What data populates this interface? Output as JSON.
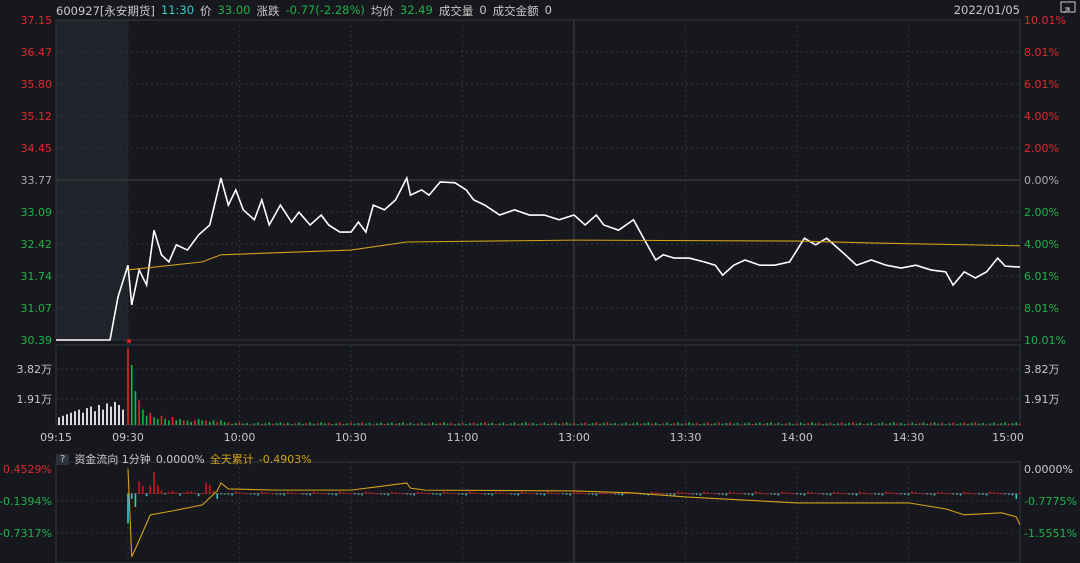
{
  "header": {
    "code_name": "600927[永安期货]",
    "time": "11:30",
    "price_label": "价",
    "price": "33.00",
    "change_label": "涨跌",
    "change": "-0.77(-2.28%)",
    "avg_label": "均价",
    "avg": "32.49",
    "volume_label": "成交量",
    "volume": "0",
    "amount_label": "成交金额",
    "amount": "0",
    "date": "2022/01/05"
  },
  "colors": {
    "up": "#e0282e",
    "down": "#1fb04a",
    "price_line": "#ffffff",
    "avg_line": "#d4a21a",
    "flow_in": "#d0161b",
    "flow_out": "#39c8c8",
    "bg": "#16181d"
  },
  "chart_data": [
    {
      "type": "line",
      "title": "分时",
      "ylim": [
        30.39,
        37.15
      ],
      "prev_close": 33.77,
      "y_ticks_left": [
        "37.15",
        "36.47",
        "35.80",
        "35.12",
        "34.45",
        "33.77",
        "33.09",
        "32.42",
        "31.74",
        "31.07",
        "30.39"
      ],
      "y_ticks_right": [
        "10.01%",
        "8.01%",
        "6.01%",
        "4.00%",
        "2.00%",
        "0.00%",
        "2.00%",
        "4.00%",
        "6.01%",
        "8.01%",
        "10.01%"
      ],
      "x_ticks": [
        "09:15",
        "09:30",
        "10:00",
        "10:30",
        "11:00",
        "13:00",
        "13:30",
        "14:00",
        "14:30",
        "15:00"
      ],
      "premarket_price": 30.39,
      "price_series": {
        "minute": [
          0,
          1,
          3,
          5,
          7,
          9,
          11,
          13,
          16,
          19,
          22,
          25,
          27,
          29,
          31,
          34,
          36,
          38,
          41,
          44,
          46,
          49,
          52,
          54,
          57,
          60,
          62,
          64,
          66,
          69,
          72,
          75,
          76,
          79,
          81,
          84,
          88,
          91,
          93,
          96,
          100,
          104,
          108,
          112,
          116,
          120,
          123,
          126,
          128,
          132,
          136,
          139,
          142,
          144,
          147,
          151,
          155,
          158,
          160,
          163,
          166,
          170,
          174,
          178,
          182,
          185,
          188,
          190,
          193,
          196,
          200,
          204,
          208,
          212,
          216,
          220,
          222,
          225,
          228,
          231,
          234,
          236,
          240
        ],
        "price": [
          31.97,
          31.13,
          31.87,
          31.55,
          32.71,
          32.19,
          32.04,
          32.4,
          32.29,
          32.61,
          32.82,
          33.81,
          33.24,
          33.56,
          33.14,
          32.93,
          33.35,
          32.82,
          33.24,
          32.88,
          33.09,
          32.82,
          33.03,
          32.82,
          32.67,
          32.67,
          32.88,
          32.67,
          33.24,
          33.14,
          33.35,
          33.81,
          33.45,
          33.56,
          33.45,
          33.73,
          33.71,
          33.56,
          33.35,
          33.24,
          33.03,
          33.14,
          33.03,
          33.03,
          32.93,
          33.03,
          32.82,
          33.03,
          32.82,
          32.71,
          32.93,
          32.5,
          32.08,
          32.19,
          32.12,
          32.12,
          32.04,
          31.97,
          31.76,
          31.97,
          32.08,
          31.97,
          31.97,
          32.04,
          32.54,
          32.4,
          32.54,
          32.4,
          32.19,
          31.97,
          32.08,
          31.97,
          31.91,
          31.97,
          31.87,
          31.83,
          31.55,
          31.83,
          31.7,
          31.83,
          32.12,
          31.95,
          31.93
        ]
      },
      "avg_series": {
        "minute": [
          0,
          20,
          25,
          60,
          75,
          120,
          180,
          200,
          240
        ],
        "price": [
          31.87,
          32.04,
          32.19,
          32.29,
          32.46,
          32.5,
          32.48,
          32.44,
          32.38
        ]
      }
    },
    {
      "type": "bar",
      "title": "成交量",
      "y_ticks": [
        "3.82万",
        "1.91万"
      ],
      "ymax_wan": 5.2,
      "premarket_volume_wan": [
        0.5,
        0.6,
        0.7,
        0.8,
        0.9,
        1.0,
        0.8,
        1.1,
        1.2,
        0.9,
        1.3,
        1.0,
        1.4,
        1.2,
        1.5,
        1.3,
        1.0
      ],
      "session_volume_wan": [
        5.0,
        3.9,
        2.2,
        1.6,
        1.0,
        0.6,
        0.8,
        0.5,
        0.4,
        0.6,
        0.4,
        0.3,
        0.5,
        0.3,
        0.4,
        0.3,
        0.3,
        0.2,
        0.3,
        0.4,
        0.3,
        0.3,
        0.2,
        0.3,
        0.2,
        0.3,
        0.2
      ],
      "baseline_volume_wan": 0.12
    },
    {
      "type": "bar",
      "title": "资金流向",
      "help": "?",
      "label": "资金流向 1分钟",
      "current": "0.0000%",
      "cum_label": "全天累计",
      "cum": "-0.4903%",
      "y_ticks_left": [
        "0.4529%",
        "-0.1394%",
        "-0.7317%"
      ],
      "y_ticks_right": [
        "0.0000%",
        "-0.7775%",
        "-1.5551%"
      ],
      "flow_pct": [
        -0.55,
        -0.1,
        -0.25,
        0.22,
        0.14,
        -0.05,
        0.15,
        0.4,
        0.16,
        0.05,
        -0.02,
        0.03,
        0.05,
        0.02,
        -0.04,
        0.01,
        0.04,
        0.04,
        0.02,
        -0.05,
        0.0,
        0.2,
        0.16,
        0.05,
        -0.1,
        -0.02
      ],
      "cum_series": {
        "minute": [
          0,
          1,
          2,
          6,
          12,
          20,
          24,
          25,
          27,
          40,
          60,
          75,
          76,
          80,
          120,
          136,
          150,
          180,
          210,
          220,
          225,
          235,
          239,
          240
        ],
        "pct": [
          0,
          -2.2,
          -2.0,
          -1.15,
          -1.05,
          -0.9,
          -0.55,
          -0.35,
          -0.5,
          -0.53,
          -0.53,
          -0.35,
          -0.48,
          -0.53,
          -0.55,
          -0.6,
          -0.7,
          -0.85,
          -0.85,
          -1.0,
          -1.15,
          -1.1,
          -1.2,
          -1.4
        ]
      }
    }
  ]
}
